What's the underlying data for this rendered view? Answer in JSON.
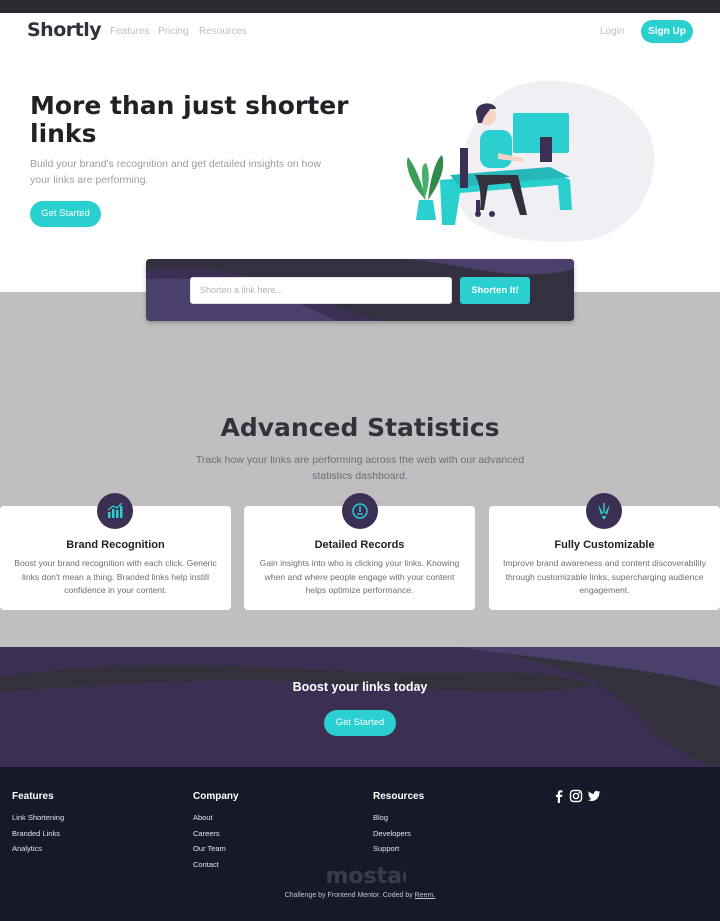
{
  "nav": {
    "logo": "Shortly",
    "links": [
      "Features",
      "Pricing",
      "Resources"
    ],
    "login": "Login",
    "signup": "Sign Up"
  },
  "hero": {
    "title": "More than just shorter links",
    "subtitle": "Build your brand's recognition and get detailed insights on how your links are performing.",
    "cta": "Get Started"
  },
  "shorten": {
    "placeholder": "Shorten a link here...",
    "button": "Shorten It!"
  },
  "stats": {
    "title": "Advanced Statistics",
    "subtitle": "Track how your links are performing across the web with our advanced statistics dashboard.",
    "cards": [
      {
        "title": "Brand Recognition",
        "text": "Boost your brand recognition with each click. Generic links don't mean a thing. Branded links help instill confidence in your content.",
        "icon": "bar-chart-icon"
      },
      {
        "title": "Detailed Records",
        "text": "Gain insights into who is clicking your links. Knowing when and where people engage with your content helps optimize performance.",
        "icon": "gauge-icon"
      },
      {
        "title": "Fully Customizable",
        "text": "Improve brand awareness and content discoverability through customizable links, supercharging audience engagement.",
        "icon": "brush-icon"
      }
    ]
  },
  "boost": {
    "title": "Boost your links today",
    "cta": "Get Started"
  },
  "footer": {
    "columns": [
      {
        "title": "Features",
        "links": [
          "Link Shortening",
          "Branded Links",
          "Analytics"
        ]
      },
      {
        "title": "Company",
        "links": [
          "About",
          "Careers",
          "Our Team",
          "Contact"
        ]
      },
      {
        "title": "Resources",
        "links": [
          "Blog",
          "Developers",
          "Support"
        ]
      }
    ],
    "social": [
      "facebook-icon",
      "instagram-icon",
      "twitter-icon"
    ],
    "attribution_prefix": "Challenge by Frontend Mentor. Coded by",
    "attribution_author": "Reem.",
    "watermark": "مستقل mostaql.com"
  },
  "colors": {
    "accent": "#2acfcf",
    "dark_violet": "#3b3054",
    "footer_bg": "#16192a",
    "gray_section": "#bfbfbf"
  }
}
